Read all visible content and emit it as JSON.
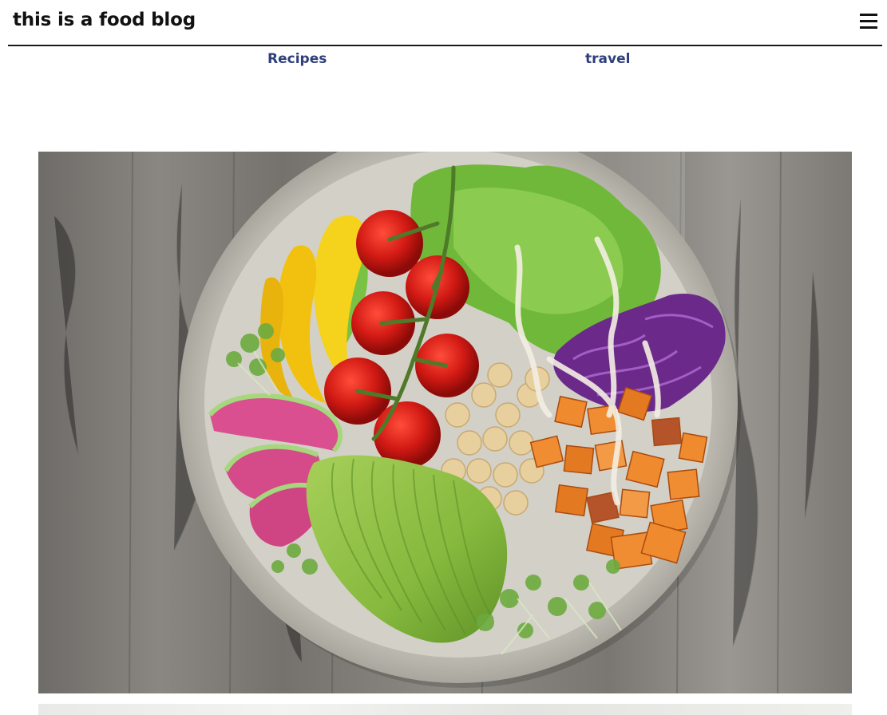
{
  "site": {
    "title": "this is a food blog"
  },
  "nav": {
    "items": [
      {
        "label": "Recipes"
      },
      {
        "label": "travel"
      }
    ]
  },
  "icons": {
    "menu": "hamburger-menu-icon"
  },
  "colors": {
    "nav_link": "#2e3f7a",
    "header_rule": "#1a1a1a"
  }
}
